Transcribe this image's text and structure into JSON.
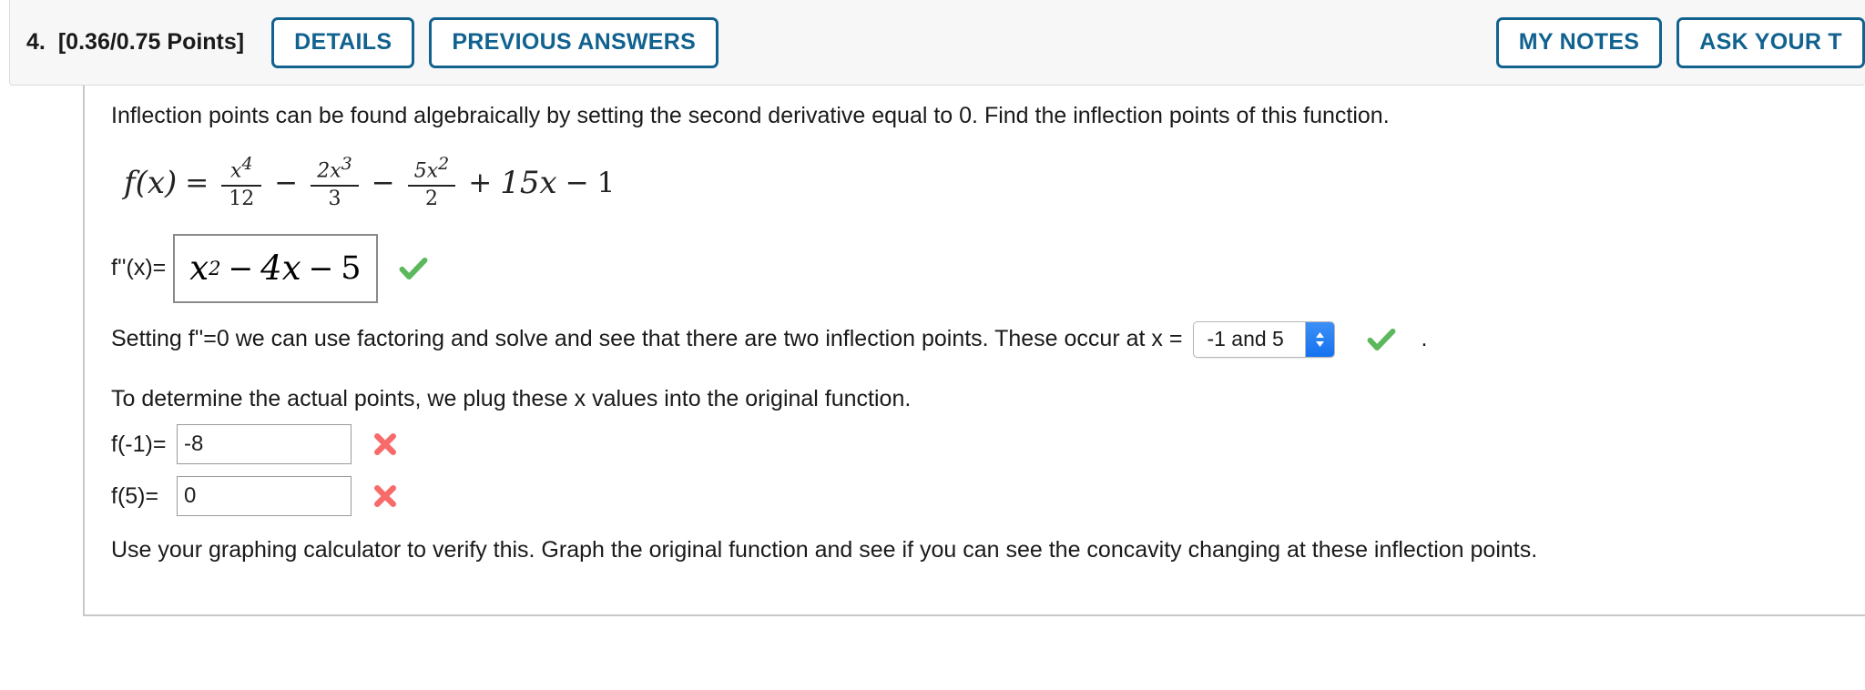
{
  "header": {
    "question_number": "4.",
    "points": "[0.36/0.75 Points]",
    "buttons": [
      {
        "label": "DETAILS",
        "name": "details-button"
      },
      {
        "label": "PREVIOUS ANSWERS",
        "name": "previous-answers-button"
      }
    ],
    "right_buttons": [
      {
        "label": "MY NOTES",
        "name": "my-notes-button"
      },
      {
        "label": "ASK YOUR T",
        "name": "ask-your-teacher-button"
      }
    ],
    "accent_color": "#11628f",
    "background_color": "#f7f7f7"
  },
  "body": {
    "intro_text": "Inflection points can be found algebraically by setting the second derivative equal to 0. Find the inflection points of this function.",
    "formula": {
      "lhs": "f(x)",
      "equals": "=",
      "term1": {
        "num": "x",
        "num_sup": "4",
        "den": "12"
      },
      "op1": "−",
      "term2": {
        "num": "2x",
        "num_sup": "3",
        "den": "3"
      },
      "op2": "−",
      "term3": {
        "num": "5x",
        "num_sup": "2",
        "den": "2"
      },
      "op3": "+",
      "term4": "15x",
      "op4": "−",
      "term5": "1",
      "plain": "f(x) = x^4/12 - 2x^3/3 - 5x^2/2 + 15x - 1"
    },
    "second_derivative": {
      "label": "f''(x)=",
      "value_base": "x",
      "value_sup": "2",
      "value_op1": "−",
      "value_term2": "4x",
      "value_op2": "−",
      "value_term3": "5",
      "value_plain": "x^2 - 4x - 5",
      "status": "correct",
      "status_icon": "green-check-icon"
    },
    "factoring_sentence_before": "Setting f''=0 we can use factoring and solve and see that there are two inflection points. These occur at x =",
    "inflection_select": {
      "value": "-1 and 5",
      "status": "correct",
      "status_icon": "green-check-icon",
      "arrow_icon": "chevron-up-down-icon"
    },
    "period": ".",
    "plug_in_text": "To determine the actual points, we plug these x values into the original function.",
    "answers": [
      {
        "label": "f(-1)=",
        "value": "-8",
        "status": "incorrect",
        "status_icon": "red-x-icon",
        "name": "f-of-negative-one"
      },
      {
        "label": "f(5)=",
        "value": "0",
        "status": "incorrect",
        "status_icon": "red-x-icon",
        "name": "f-of-five"
      }
    ],
    "closing_text": "Use your graphing calculator to verify this. Graph the original function and see if you can see the concavity changing at these inflection points."
  },
  "colors": {
    "correct": "#5cb85c",
    "incorrect": "#f76b6b",
    "select_arrow_bg": "#1572f0"
  }
}
